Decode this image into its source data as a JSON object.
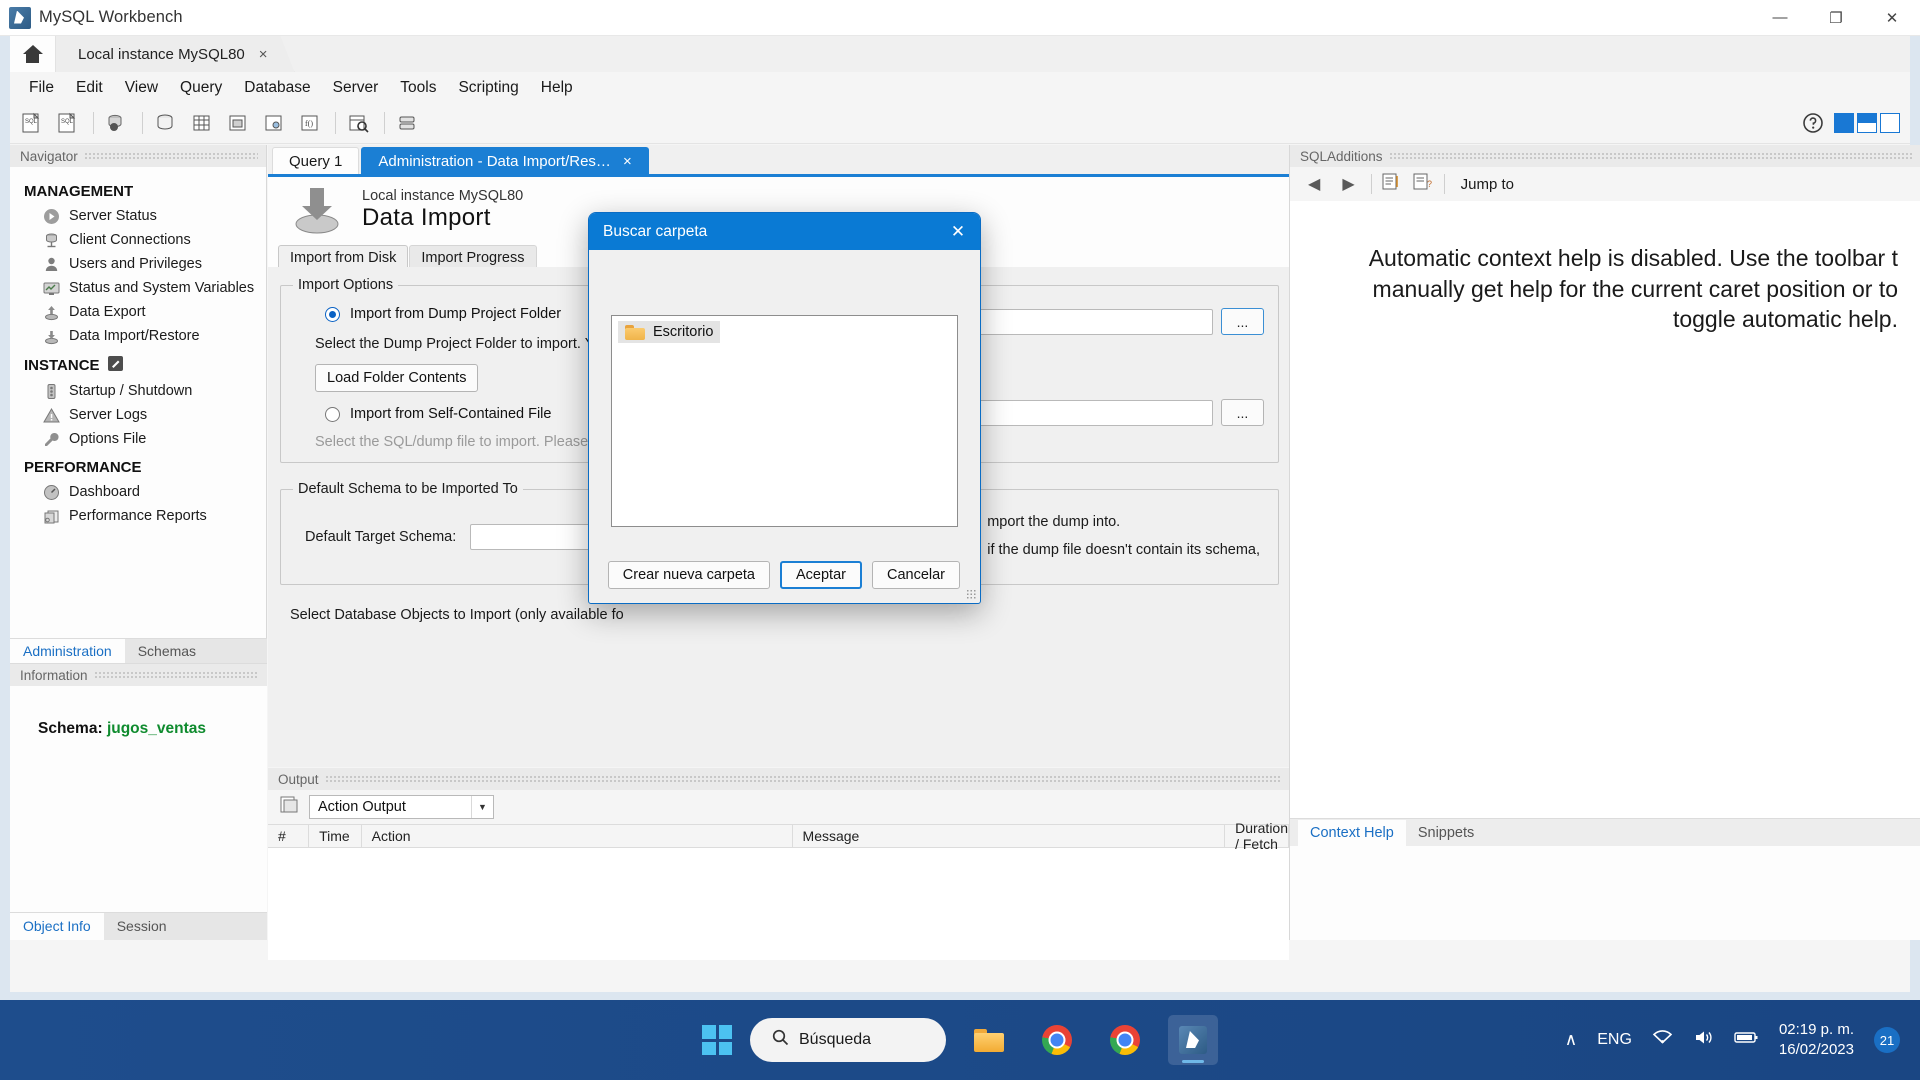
{
  "window": {
    "title": "MySQL Workbench",
    "app_icon": "mysql-workbench-icon",
    "minimize": "—",
    "maximize": "❐",
    "close": "✕"
  },
  "connection_tabs": {
    "home_icon": "home-icon",
    "tabs": [
      {
        "label": "Local instance MySQL80",
        "close": "×"
      }
    ]
  },
  "menu": {
    "items": [
      "File",
      "Edit",
      "View",
      "Query",
      "Database",
      "Server",
      "Tools",
      "Scripting",
      "Help"
    ]
  },
  "toolbar": {
    "icons": [
      "new-sql-tab-icon",
      "open-sql-script-icon",
      "manage-connections-icon",
      "new-schema-icon",
      "new-table-icon",
      "new-view-icon",
      "new-procedure-icon",
      "new-function-icon",
      "search-table-icon",
      "manage-server-icon"
    ],
    "help_icon": "help-circle-icon",
    "sidebar_toggles": [
      "toggle-sidebar-left",
      "toggle-output-area",
      "toggle-sidebar-right"
    ]
  },
  "navigator": {
    "panel_title": "Navigator",
    "sections": [
      {
        "title": "MANAGEMENT",
        "badge": null,
        "items": [
          {
            "label": "Server Status",
            "icon": "server-status-icon"
          },
          {
            "label": "Client Connections",
            "icon": "client-connections-icon"
          },
          {
            "label": "Users and Privileges",
            "icon": "users-privileges-icon"
          },
          {
            "label": "Status and System Variables",
            "icon": "status-variables-icon"
          },
          {
            "label": "Data Export",
            "icon": "data-export-icon"
          },
          {
            "label": "Data Import/Restore",
            "icon": "data-import-icon"
          }
        ]
      },
      {
        "title": "INSTANCE",
        "badge": "instance-badge-icon",
        "items": [
          {
            "label": "Startup / Shutdown",
            "icon": "startup-shutdown-icon"
          },
          {
            "label": "Server Logs",
            "icon": "server-logs-icon"
          },
          {
            "label": "Options File",
            "icon": "options-file-icon"
          }
        ]
      },
      {
        "title": "PERFORMANCE",
        "badge": null,
        "items": [
          {
            "label": "Dashboard",
            "icon": "dashboard-icon"
          },
          {
            "label": "Performance Reports",
            "icon": "performance-reports-icon"
          }
        ]
      }
    ],
    "bottom_tabs": [
      {
        "label": "Administration",
        "active": true
      },
      {
        "label": "Schemas",
        "active": false
      }
    ],
    "information": {
      "panel_title": "Information",
      "schema_label": "Schema:",
      "schema_value": "jugos_ventas",
      "tabs": [
        {
          "label": "Object Info",
          "active": true
        },
        {
          "label": "Session",
          "active": false
        }
      ]
    }
  },
  "editor": {
    "tabs": [
      {
        "label": "Query 1",
        "active": false,
        "close": null
      },
      {
        "label": "Administration - Data Import/Res…",
        "active": true,
        "close": "×"
      }
    ],
    "header": {
      "icon": "data-import-large-icon",
      "subtitle": "Local instance MySQL80",
      "title": "Data Import"
    },
    "sub_tabs": [
      {
        "label": "Import from Disk",
        "active": true
      },
      {
        "label": "Import Progress",
        "active": false
      }
    ],
    "import_options": {
      "legend": "Import Options",
      "radio_folder": {
        "label": "Import from Dump Project Folder",
        "selected": true
      },
      "folder_help": "Select the Dump Project Folder to import. You can",
      "load_folder_button": "Load Folder Contents",
      "radio_file": {
        "label": "Import from Self-Contained File",
        "selected": false
      },
      "file_help": "Select the SQL/dump file to import. Please note th",
      "browse_button_folder": "...",
      "browse_button_file": "..."
    },
    "default_schema": {
      "legend": "Default Schema to be Imported To",
      "label": "Default Target Schema:",
      "value": "",
      "help_line_1": "mport the dump into.",
      "help_line_2": "if the dump file doesn't contain its schema,"
    },
    "objects_label": "Select Database Objects to Import (only available fo"
  },
  "output": {
    "panel_title": "Output",
    "select_icon": "output-list-icon",
    "selected_view": "Action Output",
    "dropdown_arrow": "▼",
    "columns": [
      "#",
      "Time",
      "Action",
      "Message",
      "Duration / Fetch"
    ],
    "rows": []
  },
  "sql_additions": {
    "panel_title": "SQLAdditions",
    "nav_back": "◀",
    "nav_forward": "▶",
    "icons": [
      "auto-context-help-icon",
      "manual-context-help-icon"
    ],
    "jump_to_label": "Jump to",
    "message": "Automatic context help is disabled. Use the toolbar t manually get help for the current caret position or to toggle automatic help.",
    "tabs": [
      {
        "label": "Context Help",
        "active": true
      },
      {
        "label": "Snippets",
        "active": false
      }
    ]
  },
  "dialog": {
    "title": "Buscar carpeta",
    "close_icon": "close-icon",
    "tree": [
      {
        "label": "Escritorio",
        "icon": "folder-icon",
        "selected": true
      }
    ],
    "buttons": [
      {
        "label": "Crear nueva carpeta",
        "primary": false
      },
      {
        "label": "Aceptar",
        "primary": true
      },
      {
        "label": "Cancelar",
        "primary": false
      }
    ]
  },
  "taskbar": {
    "start_icon": "windows-start-icon",
    "search_icon": "search-icon",
    "search_placeholder": "Búsqueda",
    "apps": [
      {
        "name": "file-explorer-icon",
        "active": false
      },
      {
        "name": "chrome-icon",
        "active": false
      },
      {
        "name": "chrome-icon",
        "active": false
      },
      {
        "name": "mysql-workbench-icon",
        "active": true
      }
    ],
    "tray": {
      "chevron": "∧",
      "language": "ENG",
      "wifi_icon": "wifi-icon",
      "volume_icon": "volume-icon",
      "battery_icon": "battery-icon",
      "time": "02:19 p. m.",
      "date": "16/02/2023",
      "notification_count": "21"
    }
  },
  "colors": {
    "accent": "#1b7fd4",
    "dialog_title": "#0a7ad4",
    "schema_green": "#0f8b2e",
    "taskbar": "#1e4d8c"
  }
}
